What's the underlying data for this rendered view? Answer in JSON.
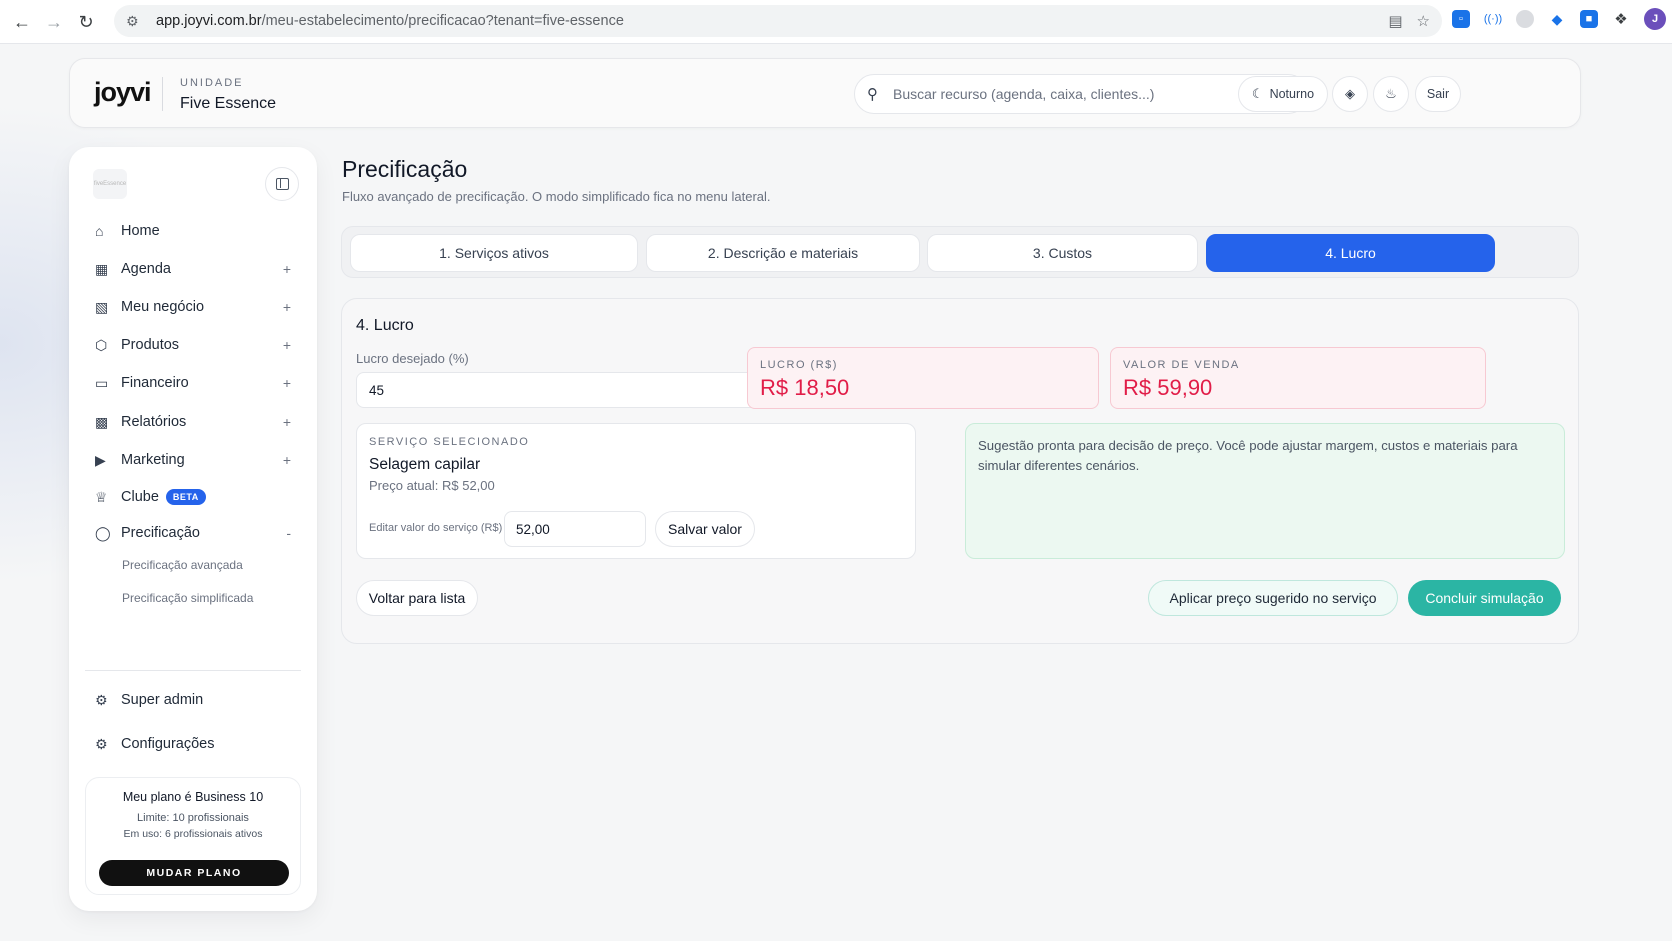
{
  "browser": {
    "url_host": "app.joyvi.com.br",
    "url_path": "/meu-estabelecimento/precificacao?tenant=five-essence",
    "profile_initial": "J"
  },
  "header": {
    "logo": "joyvi",
    "unit_label": "UNIDADE",
    "unit_name": "Five Essence",
    "search_placeholder": "Buscar recurso (agenda, caixa, clientes...)",
    "theme_button": "Noturno",
    "logout_button": "Sair"
  },
  "sidebar": {
    "logo_text": "fiveEssence",
    "items": [
      {
        "label": "Home",
        "icon": "home-icon"
      },
      {
        "label": "Agenda",
        "icon": "calendar-icon",
        "expand": "+"
      },
      {
        "label": "Meu negócio",
        "icon": "store-icon",
        "expand": "+"
      },
      {
        "label": "Produtos",
        "icon": "box-icon",
        "expand": "+"
      },
      {
        "label": "Financeiro",
        "icon": "card-icon",
        "expand": "+"
      },
      {
        "label": "Relatórios",
        "icon": "chart-icon",
        "expand": "+"
      },
      {
        "label": "Marketing",
        "icon": "megaphone-icon",
        "expand": "+"
      },
      {
        "label": "Clube",
        "icon": "crown-icon",
        "badge": "BETA"
      },
      {
        "label": "Precificação",
        "icon": "pricing-icon",
        "expand": "-"
      }
    ],
    "sub_items": [
      "Precificação avançada",
      "Precificação simplificada"
    ],
    "bottom_items": [
      {
        "label": "Super admin",
        "icon": "gear-icon"
      },
      {
        "label": "Configurações",
        "icon": "gear-icon"
      }
    ],
    "plan": {
      "title": "Meu plano é Business 10",
      "limit": "Limite: 10 profissionais",
      "in_use": "Em uso: 6 profissionais ativos",
      "button": "MUDAR PLANO"
    }
  },
  "main": {
    "title": "Precificação",
    "subtitle": "Fluxo avançado de precificação. O modo simplificado fica no menu lateral.",
    "steps": [
      {
        "label": "1. Serviços ativos",
        "active": false
      },
      {
        "label": "2. Descrição e materiais",
        "active": false
      },
      {
        "label": "3. Custos",
        "active": false
      },
      {
        "label": "4. Lucro",
        "active": true
      }
    ],
    "card": {
      "title": "4. Lucro",
      "lucro_label": "Lucro desejado (%)",
      "lucro_value": "45",
      "lucro_rs_label": "LUCRO (R$)",
      "lucro_rs_value": "R$ 18,50",
      "valor_venda_label": "VALOR DE VENDA",
      "valor_venda_value": "R$ 59,90",
      "service_label": "SERVIÇO SELECIONADO",
      "service_name": "Selagem capilar",
      "service_price": "Preço atual: R$ 52,00",
      "edit_label": "Editar valor do serviço (R$)",
      "edit_value": "52,00",
      "save_button": "Salvar valor",
      "suggestion": "Sugestão pronta para decisão de preço. Você pode ajustar margem, custos e materiais para simular diferentes cenários.",
      "back_button": "Voltar para lista",
      "apply_button": "Aplicar preço sugerido no serviço",
      "finish_button": "Concluir simulação"
    }
  },
  "colors": {
    "accent_blue": "#2563eb",
    "teal": "#2bb5a4",
    "profit_red": "#e11d48"
  }
}
